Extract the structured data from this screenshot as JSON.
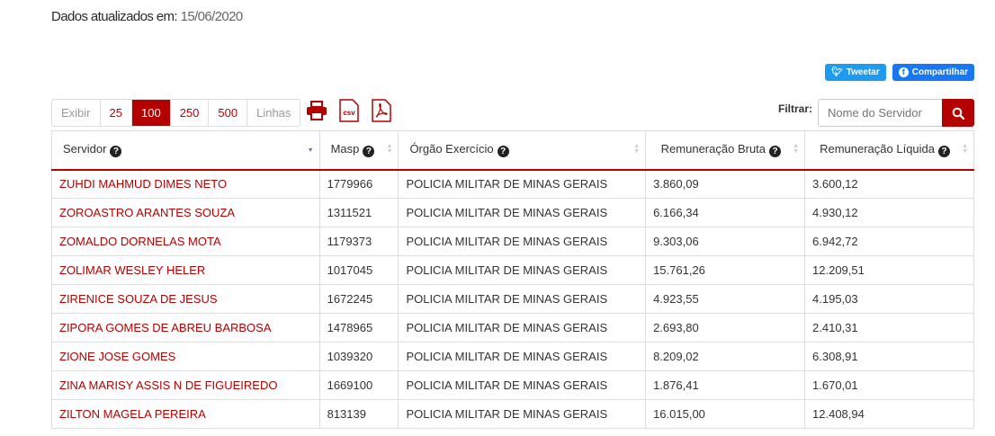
{
  "header": {
    "updated_label": "Dados atualizados em:",
    "updated_value": "15/06/2020"
  },
  "social": {
    "tweet_label": "Tweetar",
    "share_label": "Compartilhar"
  },
  "pager": {
    "show_label": "Exibir",
    "options": [
      "25",
      "100",
      "250",
      "500"
    ],
    "active": "100",
    "rows_label": "Linhas"
  },
  "export": {
    "icons": [
      "printer-icon",
      "csv-icon",
      "pdf-icon"
    ],
    "csv_text": "csv"
  },
  "filter": {
    "label": "Filtrar:",
    "placeholder": "Nome do Servidor",
    "search_icon": "search-icon"
  },
  "table": {
    "columns": [
      "Servidor",
      "Masp",
      "Órgão Exercício",
      "Remuneração Bruta",
      "Remuneração Líquida"
    ],
    "rows": [
      [
        "ZUHDI MAHMUD DIMES NETO",
        "1779966",
        "POLICIA MILITAR DE MINAS GERAIS",
        "3.860,09",
        "3.600,12"
      ],
      [
        "ZOROASTRO ARANTES SOUZA",
        "1311521",
        "POLICIA MILITAR DE MINAS GERAIS",
        "6.166,34",
        "4.930,12"
      ],
      [
        "ZOMALDO DORNELAS MOTA",
        "1179373",
        "POLICIA MILITAR DE MINAS GERAIS",
        "9.303,06",
        "6.942,72"
      ],
      [
        "ZOLIMAR WESLEY HELER",
        "1017045",
        "POLICIA MILITAR DE MINAS GERAIS",
        "15.761,26",
        "12.209,51"
      ],
      [
        "ZIRENICE SOUZA DE JESUS",
        "1672245",
        "POLICIA MILITAR DE MINAS GERAIS",
        "4.923,55",
        "4.195,03"
      ],
      [
        "ZIPORA GOMES DE ABREU BARBOSA",
        "1478965",
        "POLICIA MILITAR DE MINAS GERAIS",
        "2.693,80",
        "2.410,31"
      ],
      [
        "ZIONE JOSE GOMES",
        "1039320",
        "POLICIA MILITAR DE MINAS GERAIS",
        "8.209,02",
        "6.308,91"
      ],
      [
        "ZINA MARISY ASSIS N DE FIGUEIREDO",
        "1669100",
        "POLICIA MILITAR DE MINAS GERAIS",
        "1.876,41",
        "1.670,01"
      ],
      [
        "ZILTON MAGELA PEREIRA",
        "813139",
        "POLICIA MILITAR DE MINAS GERAIS",
        "16.015,00",
        "12.408,94"
      ]
    ]
  },
  "colors": {
    "accent": "#b50000",
    "twitter": "#1d9bf0",
    "facebook": "#1877f2"
  }
}
